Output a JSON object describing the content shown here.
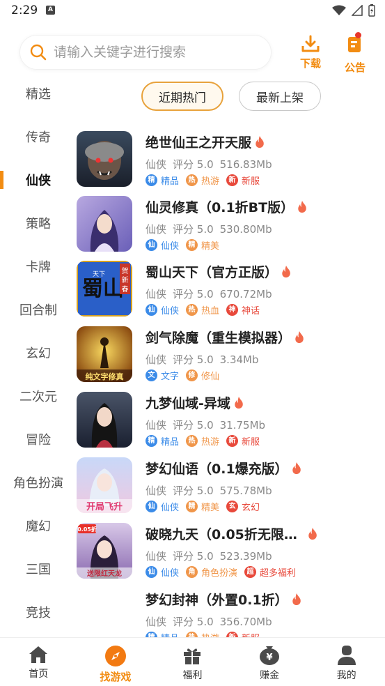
{
  "status_bar": {
    "time": "2:29",
    "notif_badge": "A"
  },
  "search": {
    "placeholder": "请输入关键字进行搜索"
  },
  "header": {
    "download_label": "下载",
    "notice_label": "公告"
  },
  "sidebar": {
    "items": [
      {
        "label": "精选",
        "active": false
      },
      {
        "label": "传奇",
        "active": false
      },
      {
        "label": "仙侠",
        "active": true
      },
      {
        "label": "策略",
        "active": false
      },
      {
        "label": "卡牌",
        "active": false
      },
      {
        "label": "回合制",
        "active": false
      },
      {
        "label": "玄幻",
        "active": false
      },
      {
        "label": "二次元",
        "active": false
      },
      {
        "label": "冒险",
        "active": false
      },
      {
        "label": "角色扮演",
        "active": false
      },
      {
        "label": "魔幻",
        "active": false
      },
      {
        "label": "三国",
        "active": false
      },
      {
        "label": "竞技",
        "active": false
      }
    ]
  },
  "filters": {
    "hot": "近期热门",
    "new": "最新上架"
  },
  "games": [
    {
      "title": "绝世仙王之开天服",
      "category": "仙侠",
      "rating": "评分 5.0",
      "size": "516.83Mb",
      "tags": [
        {
          "icon": "精",
          "label": "精品",
          "color": "#3b8be8"
        },
        {
          "icon": "热",
          "label": "热游",
          "color": "#f0964a"
        },
        {
          "icon": "新",
          "label": "新服",
          "color": "#e8493b"
        }
      ]
    },
    {
      "title": "仙灵修真（0.1折BT版）",
      "category": "仙侠",
      "rating": "评分 5.0",
      "size": "530.80Mb",
      "tags": [
        {
          "icon": "仙",
          "label": "仙侠",
          "color": "#3b8be8"
        },
        {
          "icon": "精",
          "label": "精美",
          "color": "#f0964a"
        }
      ]
    },
    {
      "title": "蜀山天下（官方正版）",
      "category": "仙侠",
      "rating": "评分 5.0",
      "size": "670.72Mb",
      "tags": [
        {
          "icon": "仙",
          "label": "仙侠",
          "color": "#3b8be8"
        },
        {
          "icon": "热",
          "label": "热血",
          "color": "#f0964a"
        },
        {
          "icon": "神",
          "label": "神话",
          "color": "#e8493b"
        }
      ]
    },
    {
      "title": "剑气除魔（重生模拟器）",
      "category": "仙侠",
      "rating": "评分 5.0",
      "size": "3.34Mb",
      "tags": [
        {
          "icon": "文",
          "label": "文字",
          "color": "#3b8be8"
        },
        {
          "icon": "修",
          "label": "修仙",
          "color": "#f0964a"
        }
      ]
    },
    {
      "title": "九梦仙域-异域",
      "category": "仙侠",
      "rating": "评分 5.0",
      "size": "31.75Mb",
      "tags": [
        {
          "icon": "精",
          "label": "精品",
          "color": "#3b8be8"
        },
        {
          "icon": "热",
          "label": "热游",
          "color": "#f0964a"
        },
        {
          "icon": "新",
          "label": "新服",
          "color": "#e8493b"
        }
      ]
    },
    {
      "title": "梦幻仙语（0.1爆充版）",
      "category": "仙侠",
      "rating": "评分 5.0",
      "size": "575.78Mb",
      "tags": [
        {
          "icon": "仙",
          "label": "仙侠",
          "color": "#3b8be8"
        },
        {
          "icon": "精",
          "label": "精美",
          "color": "#f0964a"
        },
        {
          "icon": "玄",
          "label": "玄幻",
          "color": "#e8493b"
        }
      ]
    },
    {
      "title": "破晓九天（0.05折无限…",
      "category": "仙侠",
      "rating": "评分 5.0",
      "size": "523.39Mb",
      "tags": [
        {
          "icon": "仙",
          "label": "仙侠",
          "color": "#3b8be8"
        },
        {
          "icon": "角",
          "label": "角色扮演",
          "color": "#f0964a"
        },
        {
          "icon": "超",
          "label": "超多福利",
          "color": "#e8493b"
        }
      ]
    },
    {
      "title": "梦幻封神（外置0.1折）",
      "category": "仙侠",
      "rating": "评分 5.0",
      "size": "356.70Mb",
      "tags": [
        {
          "icon": "精",
          "label": "精品",
          "color": "#3b8be8"
        },
        {
          "icon": "热",
          "label": "热游",
          "color": "#f0964a"
        },
        {
          "icon": "新",
          "label": "新服",
          "color": "#e8493b"
        }
      ]
    }
  ],
  "thumb_text": {
    "shushan_big": "蜀山",
    "shushan_small": "天下",
    "shushan_side": "贺新春",
    "jianqi": "纯文字修真",
    "menghuan": "开局飞升",
    "poxiao_corner": "0.05折",
    "poxiao_bottom": "送限红天龙"
  },
  "bottom_nav": [
    {
      "label": "首页",
      "icon": "home-icon",
      "active": false
    },
    {
      "label": "找游戏",
      "icon": "compass-icon",
      "active": true
    },
    {
      "label": "福利",
      "icon": "gift-icon",
      "active": false
    },
    {
      "label": "赚金",
      "icon": "money-bag-icon",
      "active": false
    },
    {
      "label": "我的",
      "icon": "profile-icon",
      "active": false
    }
  ],
  "colors": {
    "accent": "#f28c12",
    "flame": "#f26a4b"
  }
}
